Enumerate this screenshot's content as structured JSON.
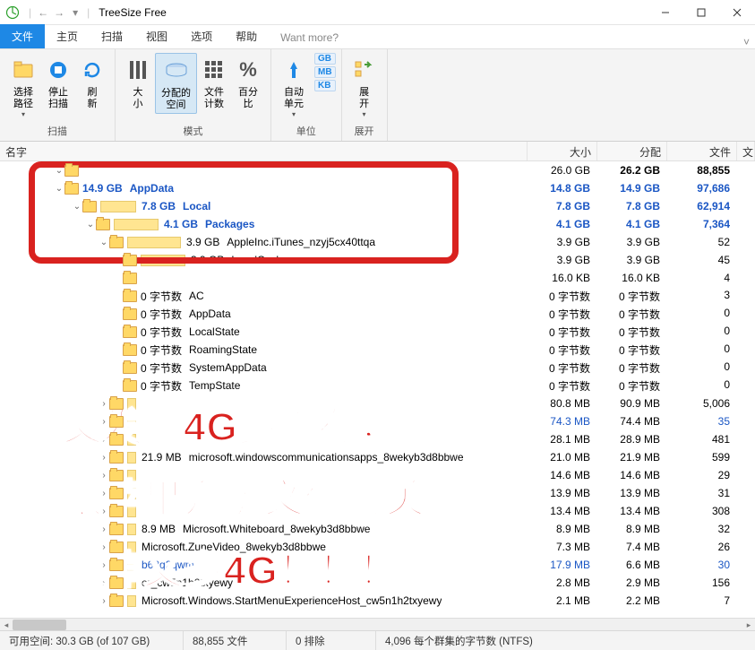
{
  "window": {
    "title": "TreeSize Free",
    "tabs": [
      "文件",
      "主页",
      "扫描",
      "视图",
      "选项",
      "帮助",
      "Want more?"
    ],
    "active_tab_index": 0
  },
  "ribbon": {
    "groups": [
      {
        "label": "扫描",
        "items": [
          {
            "label": "选择\n路径",
            "icon": "path",
            "dropdown": true
          },
          {
            "label": "停止\n扫描",
            "icon": "stop"
          },
          {
            "label": "刷\n新",
            "icon": "refresh"
          }
        ]
      },
      {
        "label": "模式",
        "items": [
          {
            "label": "大\n小",
            "icon": "size"
          },
          {
            "label": "分配的\n空间",
            "icon": "allocated",
            "selected": true
          },
          {
            "label": "文件\n计数",
            "icon": "count"
          },
          {
            "label": "百分\n比",
            "icon": "percent"
          }
        ]
      },
      {
        "label": "单位",
        "items": [
          {
            "label": "自动\n单元",
            "icon": "auto-unit",
            "dropdown": true,
            "units": [
              "GB",
              "MB",
              "KB"
            ]
          }
        ]
      },
      {
        "label": "展开",
        "items": [
          {
            "label": "展\n开",
            "icon": "expand",
            "dropdown": true
          }
        ]
      }
    ]
  },
  "columns": {
    "name": "名字",
    "size": "大小",
    "alloc": "分配",
    "files": "文件",
    "last": "文"
  },
  "rows": [
    {
      "indent": 60,
      "expand": "v",
      "bar": 0,
      "size": "",
      "name": "",
      "c1": "26.0 GB",
      "c2": "26.2 GB",
      "c2b": true,
      "c3": "88,855",
      "c3b": true
    },
    {
      "indent": 60,
      "expand": "v",
      "bar": 0,
      "size": "14.9 GB",
      "name": "AppData",
      "blue": true,
      "c1": "14.8 GB",
      "c2": "14.9 GB",
      "c3": "97,686"
    },
    {
      "indent": 80,
      "expand": "v",
      "bar": 40,
      "size": "7.8 GB",
      "name": "Local",
      "blue": true,
      "c1": "7.8 GB",
      "c2": "7.8 GB",
      "c3": "62,914"
    },
    {
      "indent": 95,
      "expand": "v",
      "bar": 50,
      "size": "4.1 GB",
      "name": "Packages",
      "blue": true,
      "c1": "4.1 GB",
      "c2": "4.1 GB",
      "c3": "7,364"
    },
    {
      "indent": 110,
      "expand": "v",
      "bar": 60,
      "size": "3.9 GB",
      "name": "AppleInc.iTunes_nzyj5cx40ttqa",
      "c1": "3.9 GB",
      "c2": "3.9 GB",
      "c3": "52"
    },
    {
      "indent": 125,
      "expand": ">",
      "bar": 50,
      "size": "3.9 GB",
      "name": "LocalCache",
      "c1": "3.9 GB",
      "c2": "3.9 GB",
      "c3": "45"
    },
    {
      "indent": 125,
      "expand": "",
      "bar": 0,
      "size": "",
      "name": "",
      "c1": "16.0 KB",
      "c2": "16.0 KB",
      "c3": "4"
    },
    {
      "indent": 125,
      "expand": "",
      "bar": 0,
      "size": "0 字节数",
      "name": "AC",
      "c1": "0 字节数",
      "c2": "0 字节数",
      "c3": "3"
    },
    {
      "indent": 125,
      "expand": "",
      "bar": 0,
      "size": "0 字节数",
      "name": "AppData",
      "c1": "0 字节数",
      "c2": "0 字节数",
      "c3": "0"
    },
    {
      "indent": 125,
      "expand": "",
      "bar": 0,
      "size": "0 字节数",
      "name": "LocalState",
      "c1": "0 字节数",
      "c2": "0 字节数",
      "c3": "0"
    },
    {
      "indent": 125,
      "expand": "",
      "bar": 0,
      "size": "0 字节数",
      "name": "RoamingState",
      "c1": "0 字节数",
      "c2": "0 字节数",
      "c3": "0"
    },
    {
      "indent": 125,
      "expand": "",
      "bar": 0,
      "size": "0 字节数",
      "name": "SystemAppData",
      "c1": "0 字节数",
      "c2": "0 字节数",
      "c3": "0"
    },
    {
      "indent": 125,
      "expand": "",
      "bar": 0,
      "size": "0 字节数",
      "name": "TempState",
      "c1": "0 字节数",
      "c2": "0 字节数",
      "c3": "0"
    },
    {
      "indent": 110,
      "expand": ">",
      "bar": 10,
      "size": "",
      "name": "",
      "c1": "80.8 MB",
      "c2": "90.9 MB",
      "c3": "5,006"
    },
    {
      "indent": 110,
      "expand": ">",
      "bar": 10,
      "size": "",
      "name": "",
      "blue_link": true,
      "c1": "74.3 MB",
      "c2": "74.4 MB",
      "c3": "35"
    },
    {
      "indent": 110,
      "expand": ">",
      "bar": 10,
      "size": "",
      "name": "",
      "c1": "28.1 MB",
      "c2": "28.9 MB",
      "c3": "481"
    },
    {
      "indent": 110,
      "expand": ">",
      "bar": 10,
      "size": "21.9 MB",
      "name": "microsoft.windowscommunicationsapps_8wekyb3d8bbwe",
      "c1": "21.0 MB",
      "c2": "21.9 MB",
      "c3": "599"
    },
    {
      "indent": 110,
      "expand": ">",
      "bar": 10,
      "size": "",
      "name": "",
      "c1": "14.6 MB",
      "c2": "14.6 MB",
      "c3": "29"
    },
    {
      "indent": 110,
      "expand": ">",
      "bar": 10,
      "size": "",
      "name": "",
      "c1": "13.9 MB",
      "c2": "13.9 MB",
      "c3": "31"
    },
    {
      "indent": 110,
      "expand": ">",
      "bar": 10,
      "size": "",
      "name": "",
      "c1": "13.4 MB",
      "c2": "13.4 MB",
      "c3": "308"
    },
    {
      "indent": 110,
      "expand": ">",
      "bar": 10,
      "size": "8.9 MB",
      "name": "Microsoft.Whiteboard_8wekyb3d8bbwe",
      "c1": "8.9 MB",
      "c2": "8.9 MB",
      "c3": "32"
    },
    {
      "indent": 110,
      "expand": ">",
      "bar": 10,
      "size": "",
      "name": "Microsoft.ZuneVideo_8wekyb3d8bbwe",
      "c1": "7.3 MB",
      "c2": "7.4 MB",
      "c3": "26"
    },
    {
      "indent": 110,
      "expand": ">",
      "bar": 10,
      "size": "",
      "name": "b62q2qwm",
      "blue_link": true,
      "c1": "17.9 MB",
      "c2": "6.6 MB",
      "c3": "30"
    },
    {
      "indent": 110,
      "expand": ">",
      "bar": 10,
      "size": "",
      "name": "er_cw5n1h2txyewy",
      "c1": "2.8 MB",
      "c2": "2.9 MB",
      "c3": "156"
    },
    {
      "indent": 110,
      "expand": ">",
      "bar": 10,
      "size": "",
      "name": "Microsoft.Windows.StartMenuExperienceHost_cw5n1h2txyewy",
      "c1": "2.1 MB",
      "c2": "2.2 MB",
      "c3": "7"
    }
  ],
  "overlay": {
    "line1": "又发现4G多缓存，",
    "line2": "跟苹果升级文件有关。",
    "line3": "删掉又多4G！！！"
  },
  "status": {
    "free": "可用空间: 30.3 GB  (of 107 GB)",
    "files": "88,855 文件",
    "excl": "0 排除",
    "cluster": "4,096 每个群集的字节数 (NTFS)"
  }
}
